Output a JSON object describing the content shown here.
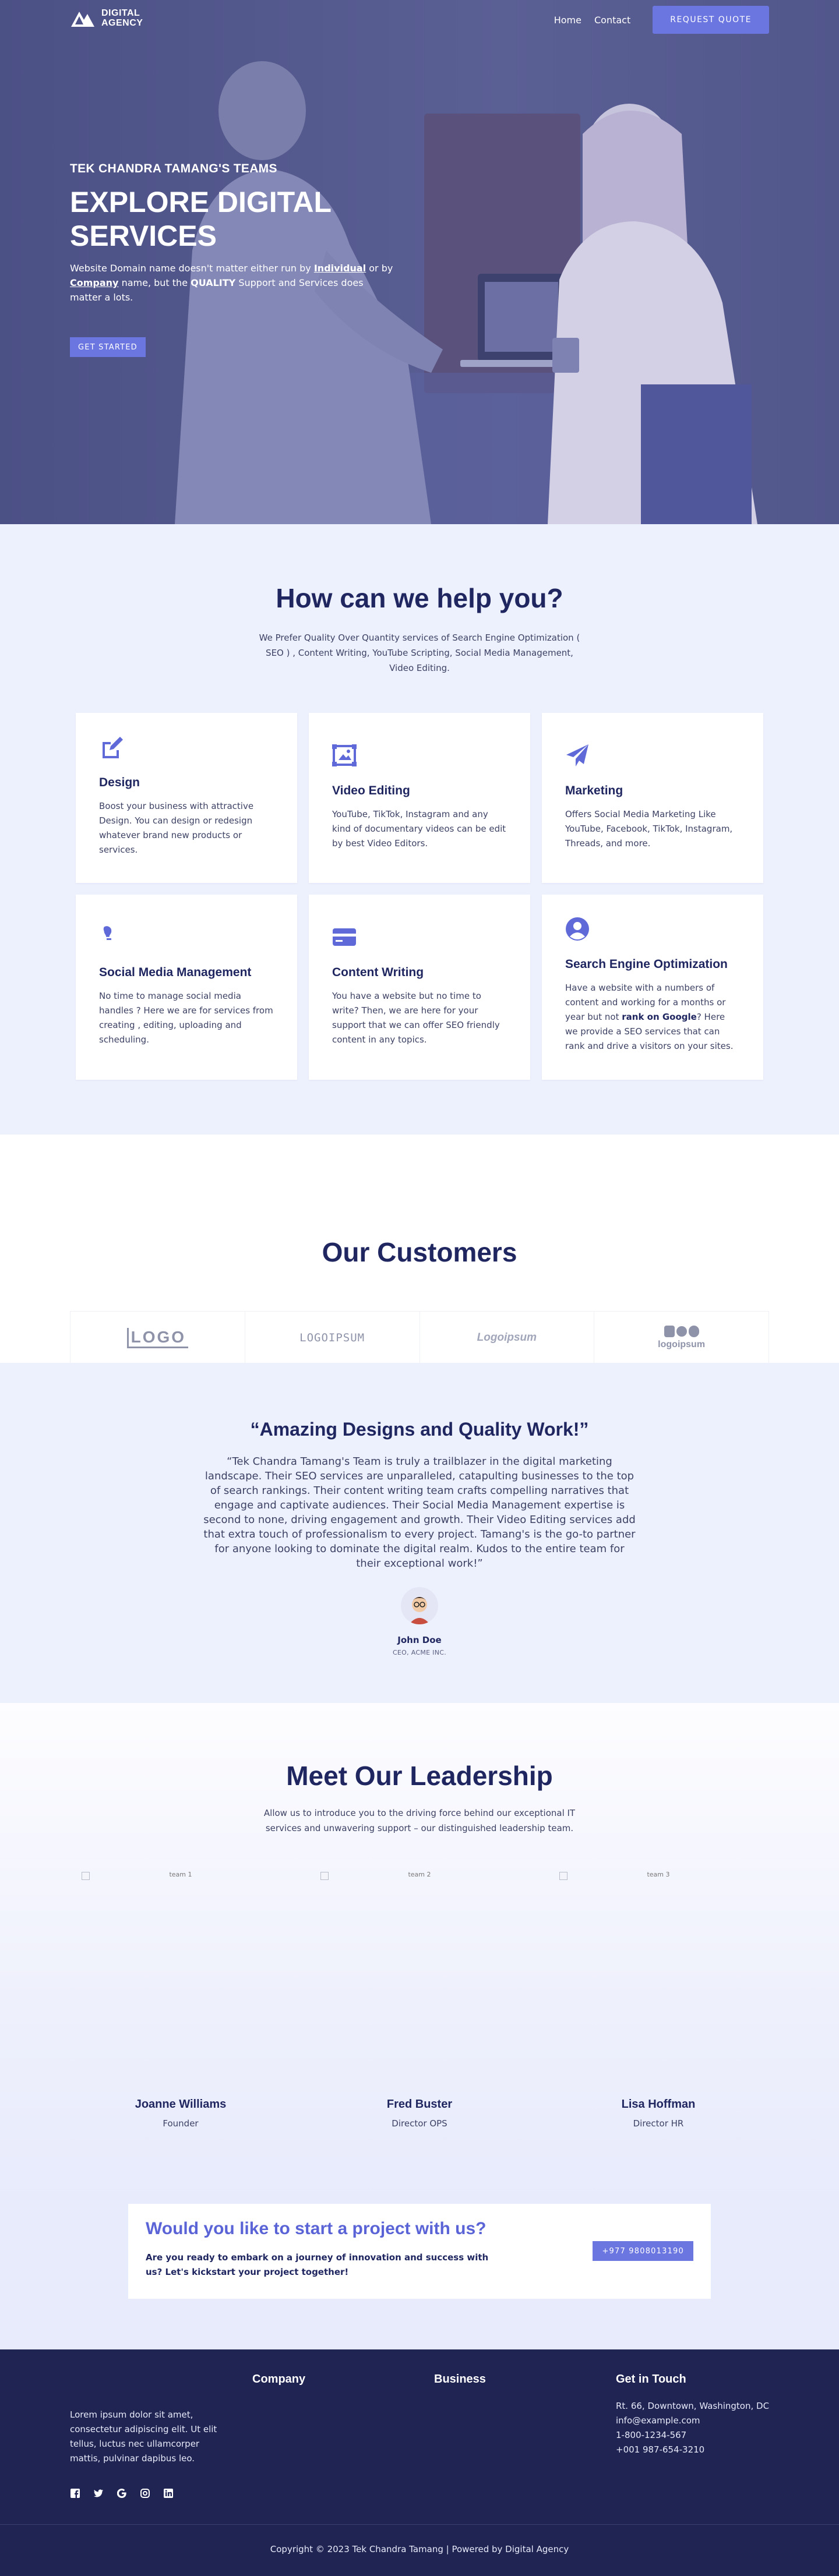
{
  "nav": {
    "logo_line1": "DIGITAL",
    "logo_line2": "AGENCY",
    "links": [
      "Home",
      "Contact"
    ],
    "quote_button": "REQUEST QUOTE"
  },
  "hero": {
    "kicker": "TEK CHANDRA TAMANG'S TEAMS",
    "title_line1": "EXPLORE DIGITAL",
    "title_line2": "SERVICES",
    "desc_1": "Website Domain name doesn't matter either run by ",
    "desc_individual": "Individual",
    "desc_2": " or by ",
    "desc_company": "Company",
    "desc_3": " name, but the ",
    "desc_quality": "QUALITY",
    "desc_4": " Support and Services does matter a lots.",
    "cta": "GET STARTED"
  },
  "services": {
    "title": "How can we help you?",
    "subtitle": "We Prefer Quality Over Quantity services of Search Engine Optimization ( SEO ) , Content Writing, YouTube Scripting, Social Media Management, Video Editing.",
    "items": [
      {
        "icon": "pencil-square-icon",
        "title": "Design",
        "text": "Boost your business with attractive Design. You can design or redesign whatever brand new products or services."
      },
      {
        "icon": "video-frame-icon",
        "title": "Video Editing",
        "text": "YouTube, TikTok, Instagram and any kind of documentary videos can be edit by best Video Editors."
      },
      {
        "icon": "paper-plane-icon",
        "title": "Marketing",
        "text": "Offers Social Media Marketing Like YouTube, Facebook, TikTok, Instagram, Threads, and more."
      },
      {
        "icon": "lightbulb-icon",
        "title": "Social Media Management",
        "text": "No time to manage social media handles ? Here we are for services from creating , editing, uploading and scheduling."
      },
      {
        "icon": "credit-card-icon",
        "title": "Content Writing",
        "text": "You have a website but no time to write? Then, we are here for your support that we can offer SEO friendly content in any topics."
      },
      {
        "icon": "user-circle-icon",
        "title": "Search Engine Optimization",
        "text_1": "Have a website with a numbers of content and working for a months or year but not ",
        "text_bold": "rank on Google",
        "text_2": "? Here we provide a SEO services that can rank and drive a visitors on your sites."
      }
    ]
  },
  "customers": {
    "title": "Our Customers",
    "logos": [
      "LOGO",
      "LOGOIPSUM",
      "Logoipsum",
      "logoipsum"
    ]
  },
  "testimonial": {
    "title": "“Amazing Designs and Quality Work!”",
    "text": "“Tek Chandra Tamang's Team is truly a trailblazer in the digital marketing landscape. Their SEO services are unparalleled, catapulting businesses to the top of search rankings. Their content writing team crafts compelling narratives that engage and captivate audiences. Their Social Media Management expertise is second to none, driving engagement and growth. Their Video Editing services add that extra touch of professionalism to every project. Tamang's is the go-to partner for anyone looking to dominate the digital realm. Kudos to the entire team for their exceptional work!”",
    "name": "John Doe",
    "role": "CEO, ACME INC."
  },
  "leadership": {
    "title": "Meet Our Leadership",
    "subtitle": "Allow us to introduce you to the driving force behind our exceptional IT services and unwavering support – our distinguished leadership team.",
    "members": [
      {
        "alt": "team 1",
        "name": "Joanne Williams",
        "role": "Founder"
      },
      {
        "alt": "team 2",
        "name": "Fred Buster",
        "role": "Director OPS"
      },
      {
        "alt": "team 3",
        "name": "Lisa Hoffman",
        "role": "Director HR"
      }
    ]
  },
  "cta": {
    "title": "Would you like to start a project with us?",
    "text": "Are you ready to embark on a journey of innovation and success with us? Let's kickstart your project together!",
    "button": "+977 9808013190"
  },
  "footer": {
    "about": "Lorem ipsum dolor sit amet, consectetur adipiscing elit. Ut elit tellus, luctus nec ullamcorper mattis, pulvinar dapibus leo.",
    "company_heading": "Company",
    "business_heading": "Business",
    "contact_heading": "Get in Touch",
    "contact_lines": [
      "Rt. 66, Downtown, Washington, DC",
      "info@example.com",
      "1-800-1234-567",
      "+001 987-654-3210"
    ],
    "socials": [
      "facebook-icon",
      "twitter-icon",
      "google-icon",
      "instagram-icon",
      "linkedin-icon"
    ],
    "copyright": "Copyright © 2023 Tek Chandra Tamang | Powered by Digital Agency"
  },
  "colors": {
    "accent": "#6b76e0",
    "navy": "#1f2453",
    "section_bg": "#edf0fd",
    "hero_overlay": "#4c5287"
  }
}
